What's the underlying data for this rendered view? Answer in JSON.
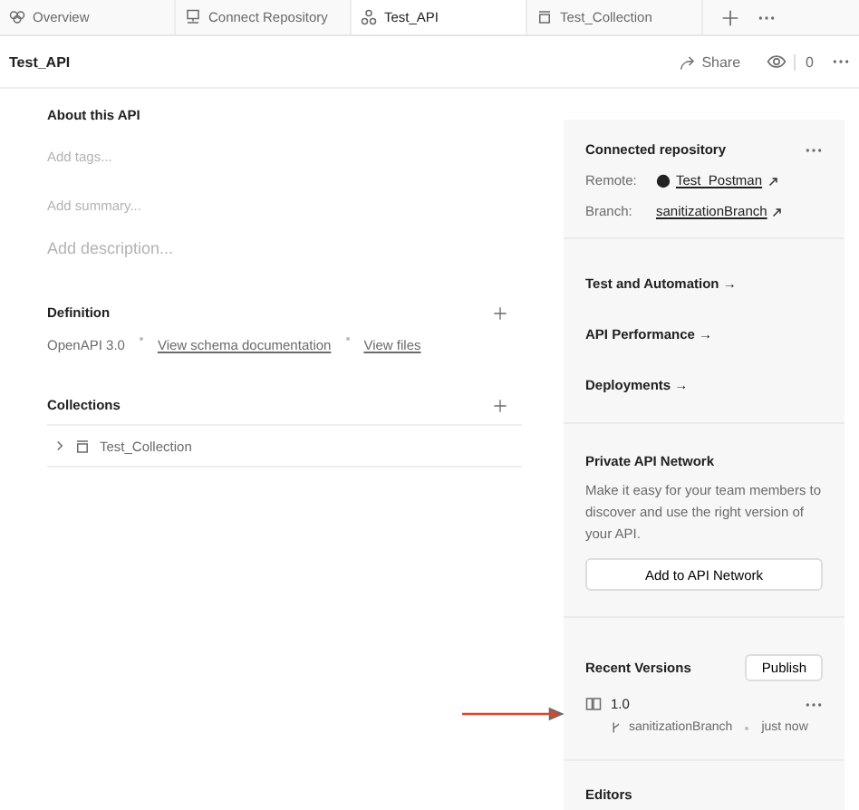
{
  "tabs": [
    {
      "label": "Overview",
      "selected": false
    },
    {
      "label": "Connect Repository",
      "selected": false
    },
    {
      "label": "Test_API",
      "selected": true
    },
    {
      "label": "Test_Collection",
      "selected": false
    }
  ],
  "header": {
    "title": "Test_API",
    "share": "Share",
    "watch_count": "0"
  },
  "about": {
    "title": "About this API",
    "tags_placeholder": "Add tags...",
    "summary_placeholder": "Add summary...",
    "description_placeholder": "Add description..."
  },
  "definition": {
    "title": "Definition",
    "format": "OpenAPI 3.0",
    "links": [
      "View schema documentation",
      "View files"
    ]
  },
  "collections": {
    "title": "Collections",
    "items": [
      {
        "name": "Test_Collection",
        "expanded": false
      }
    ]
  },
  "repository": {
    "title": "Connected repository",
    "remote_label": "Remote:",
    "remote": "Test_Postman",
    "branch_label": "Branch:",
    "branch": "sanitizationBranch"
  },
  "links": [
    "Test and Automation →",
    "API Performance →",
    "Deployments →"
  ],
  "network": {
    "title": "Private API Network",
    "text": "Make it easy for your team members to discover and use the right version of your API.",
    "button": "Add to API Network"
  },
  "versions": {
    "title": "Recent Versions",
    "publish": "Publish",
    "items": [
      {
        "name": "1.0",
        "branch": "sanitizationBranch",
        "time": "just now"
      }
    ]
  },
  "editors": {
    "title": "Editors"
  }
}
